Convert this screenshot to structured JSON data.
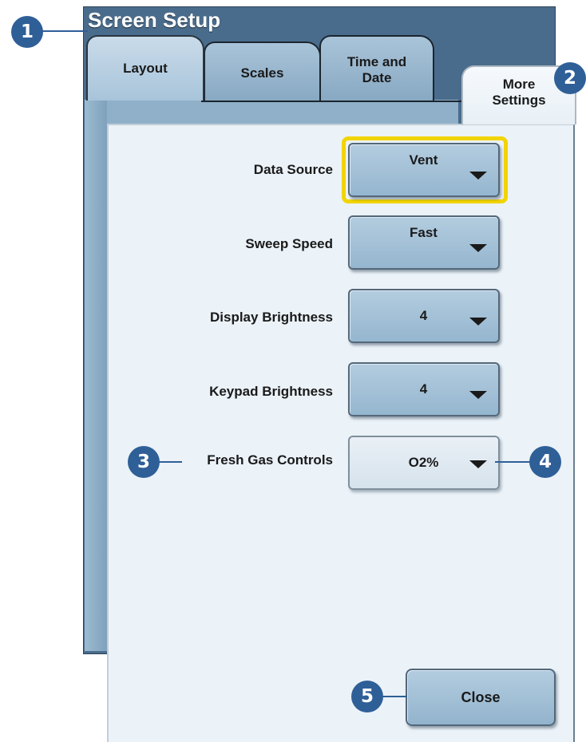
{
  "window": {
    "title": "Screen Setup"
  },
  "tabs": [
    {
      "label": "Layout"
    },
    {
      "label": "Scales"
    },
    {
      "label": "Time and\nDate"
    },
    {
      "label": "More\nSettings"
    }
  ],
  "settings": [
    {
      "label": "Data Source",
      "value": "Vent"
    },
    {
      "label": "Sweep Speed",
      "value": "Fast"
    },
    {
      "label": "Display Brightness",
      "value": "4"
    },
    {
      "label": "Keypad Brightness",
      "value": "4"
    },
    {
      "label": "Fresh Gas Controls",
      "value": "O2%"
    }
  ],
  "close_label": "Close",
  "callouts": [
    "1",
    "2",
    "3",
    "4",
    "5"
  ],
  "colors": {
    "callout": "#2f5f97",
    "highlight": "#f2d400",
    "window_frame": "#4a6c8c",
    "panel": "#ebf2f8"
  },
  "icons": {
    "dropdown": "triangle-down-icon"
  }
}
